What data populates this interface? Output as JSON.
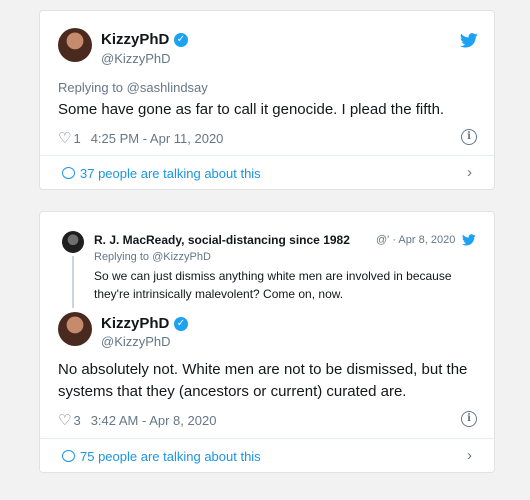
{
  "tweet1": {
    "name": "KizzyPhD",
    "handle": "@KizzyPhD",
    "replying_to": "Replying to @sashlindsay",
    "text": "Some have gone as far to call it genocide. I plead the fifth.",
    "likes": "1",
    "timestamp": "4:25 PM - Apr 11, 2020",
    "talking": "37 people are talking about this"
  },
  "tweet2": {
    "quoted": {
      "name": "R. J. MacReady, social-distancing since 1982",
      "meta": "@' · Apr 8, 2020",
      "replying_to": "Replying to @KizzyPhD",
      "text_line1": "So we can just dismiss anything white men are involved in because",
      "text_line2": "they're intrinsically malevolent? Come on, now."
    },
    "name": "KizzyPhD",
    "handle": "@KizzyPhD",
    "text_line1": "No absolutely not. White men are not to be dismissed, but the",
    "text_line2": "systems that they (ancestors or current) curated are.",
    "likes": "3",
    "timestamp": "3:42 AM - Apr 8, 2020",
    "talking": "75 people are talking about this"
  },
  "colors": {
    "twitter_blue": "#1da1f2",
    "link_blue": "#1b95e0",
    "muted": "#657786"
  }
}
